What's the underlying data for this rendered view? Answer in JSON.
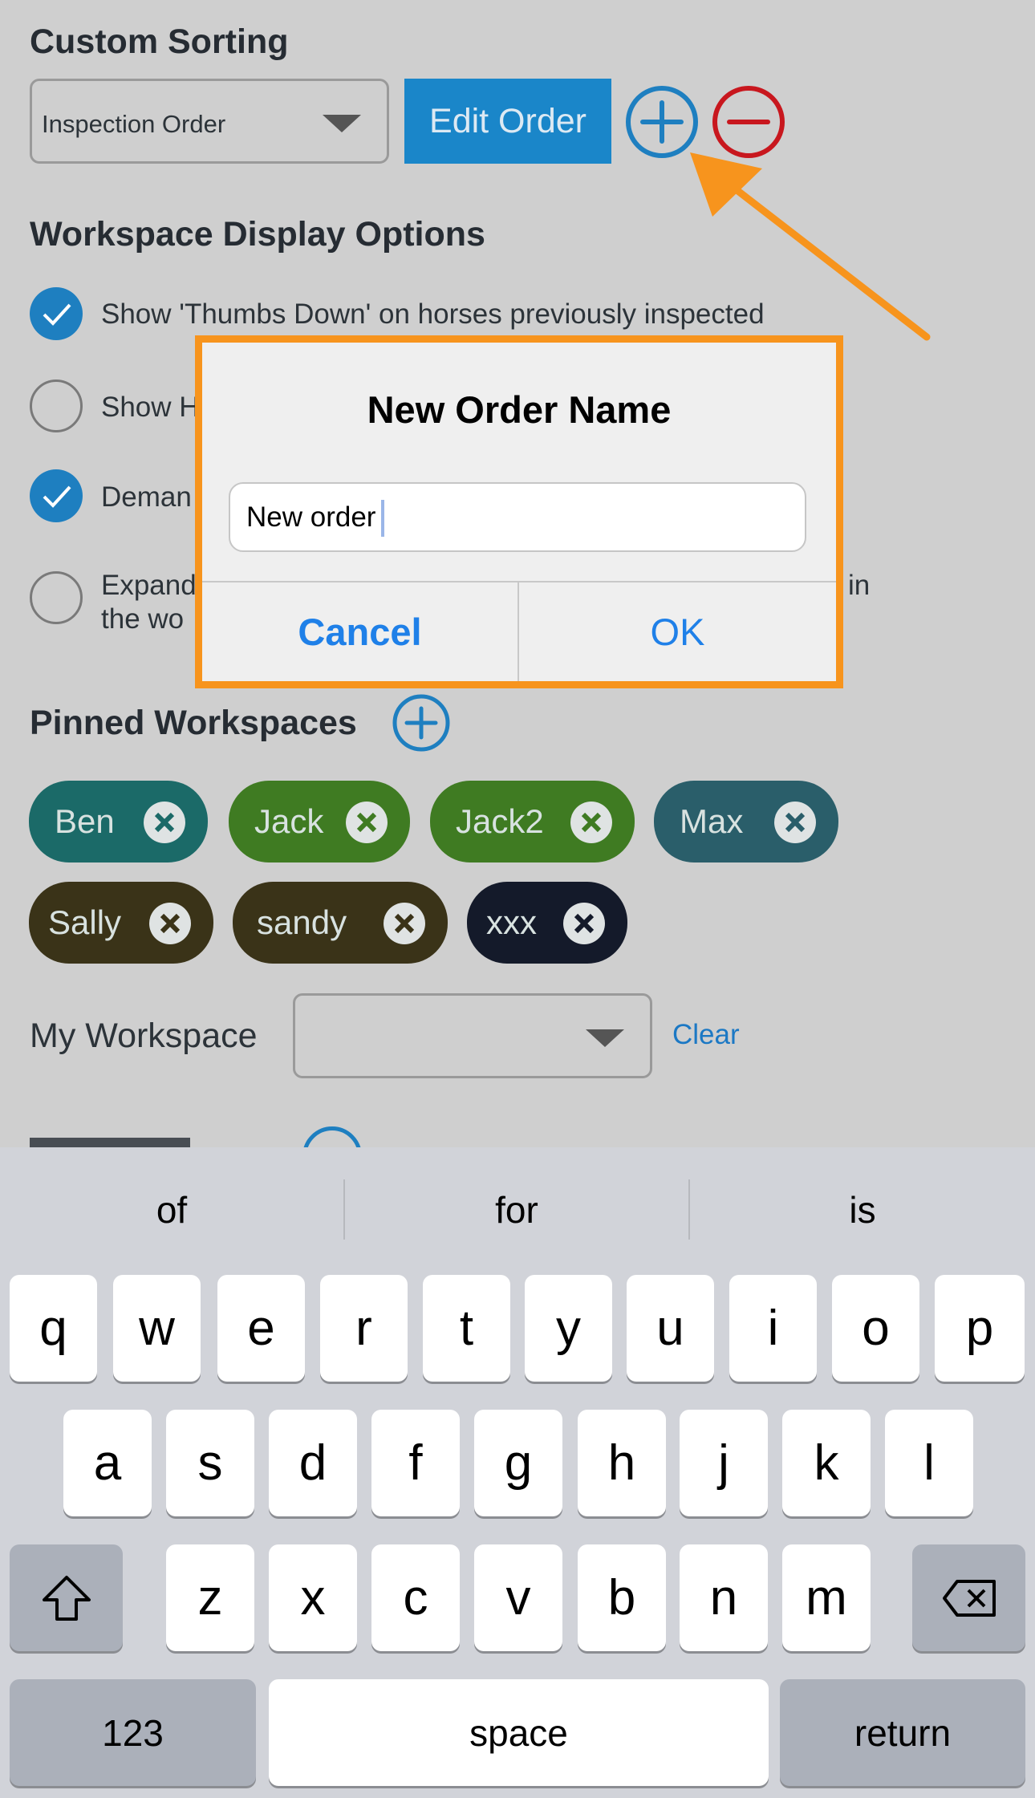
{
  "custom_sorting": {
    "title": "Custom Sorting",
    "select_value": "Inspection Order",
    "edit_order_label": "Edit Order"
  },
  "display_options": {
    "title": "Workspace Display Options",
    "options": [
      {
        "text": "Show 'Thumbs Down' on horses previously inspected",
        "checked": true
      },
      {
        "text": "Show H",
        "checked": false
      },
      {
        "text": "Deman",
        "checked": true
      },
      {
        "text_line1": "Expand",
        "text_line2": "the wo",
        "text_tail": "in",
        "checked": false
      }
    ]
  },
  "dialog": {
    "title": "New Order Name",
    "input_value": "New order",
    "cancel_label": "Cancel",
    "ok_label": "OK"
  },
  "pinned": {
    "title": "Pinned Workspaces",
    "chips": [
      {
        "label": "Ben",
        "color": "#1b6a68"
      },
      {
        "label": "Jack",
        "color": "#3f7b22"
      },
      {
        "label": "Jack2",
        "color": "#3f7b22"
      },
      {
        "label": "Max",
        "color": "#2a5e6a"
      },
      {
        "label": "Sally",
        "color": "#3a3318"
      },
      {
        "label": "sandy",
        "color": "#3a3318"
      },
      {
        "label": "xxx",
        "color": "#141a2a"
      }
    ]
  },
  "my_workspace": {
    "label": "My Workspace",
    "clear_label": "Clear"
  },
  "keyboard": {
    "suggestions": [
      "of",
      "for",
      "is"
    ],
    "row1": [
      "q",
      "w",
      "e",
      "r",
      "t",
      "y",
      "u",
      "i",
      "o",
      "p"
    ],
    "row2": [
      "a",
      "s",
      "d",
      "f",
      "g",
      "h",
      "j",
      "k",
      "l"
    ],
    "row3": [
      "z",
      "x",
      "c",
      "v",
      "b",
      "n",
      "m"
    ],
    "numbers_label": "123",
    "space_label": "space",
    "return_label": "return"
  },
  "colors": {
    "accent": "#1e88d0",
    "remove_red": "#c8171e",
    "highlight_orange": "#f7941d"
  }
}
